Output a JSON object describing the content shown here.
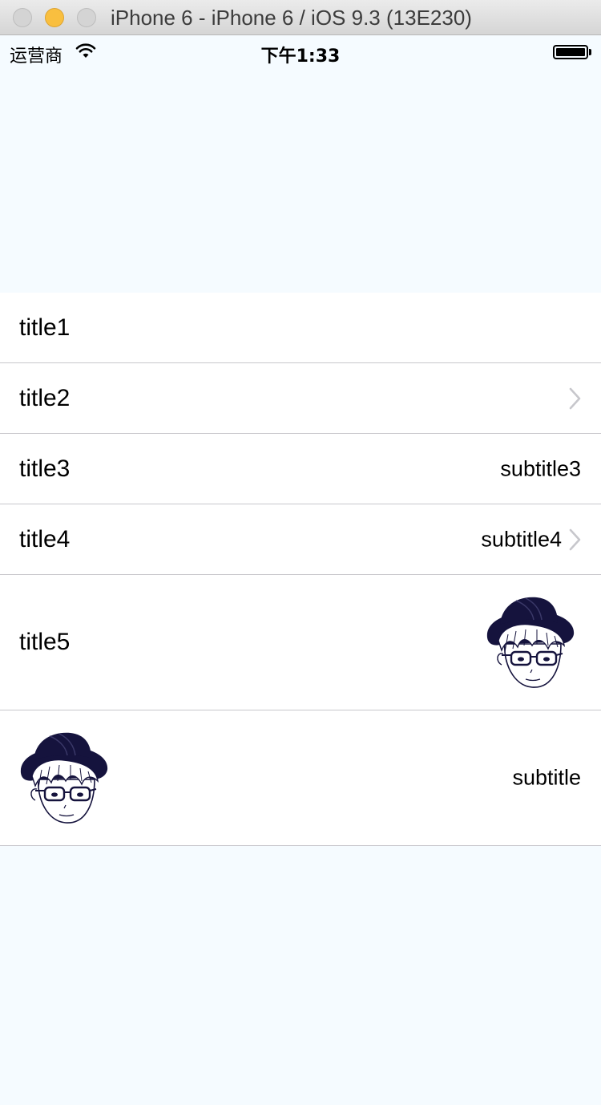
{
  "window": {
    "title": "iPhone 6 - iPhone 6 / iOS 9.3 (13E230)"
  },
  "statusbar": {
    "carrier": "运营商",
    "time": "下午1:33",
    "battery_level": 1.0
  },
  "cells": [
    {
      "title": "title1",
      "subtitle": "",
      "accessory": "none"
    },
    {
      "title": "title2",
      "subtitle": "",
      "accessory": "chevron-right-icon"
    },
    {
      "title": "title3",
      "subtitle": "subtitle3",
      "accessory": "none"
    },
    {
      "title": "title4",
      "subtitle": "subtitle4",
      "accessory": "chevron-right-icon"
    },
    {
      "title": "title5",
      "subtitle": "",
      "accessory": "avatar-image"
    },
    {
      "title": "",
      "subtitle": "subtitle",
      "accessory": "none",
      "leading_image": "avatar-image"
    }
  ],
  "colors": {
    "background": "#f5fbff",
    "cell_background": "#ffffff",
    "separator": "#c8c7cc",
    "chevron": "#c7c7cc",
    "avatar_hat": "#15133d"
  }
}
